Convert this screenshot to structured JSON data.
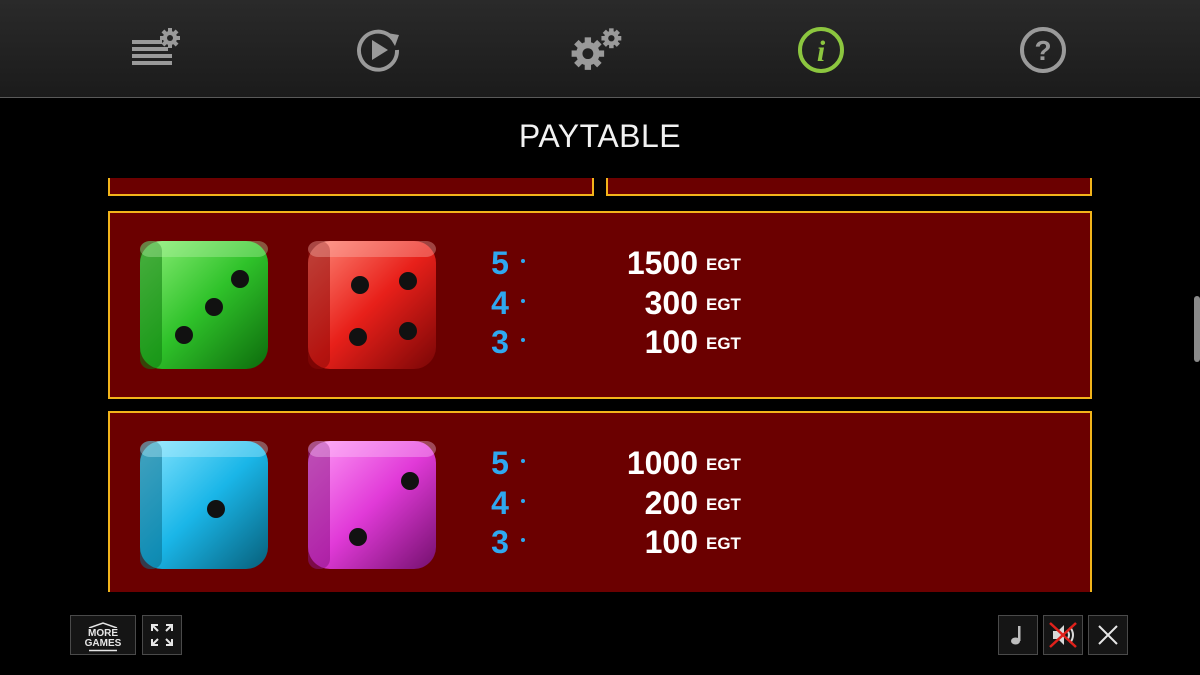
{
  "toolbar": {
    "buttons": [
      {
        "name": "bet-settings-icon"
      },
      {
        "name": "autoplay-icon"
      },
      {
        "name": "settings-icon"
      },
      {
        "name": "info-icon",
        "active": true
      },
      {
        "name": "help-icon"
      }
    ],
    "colors": {
      "icon": "#9a9a9a",
      "active": "#8cc63f"
    }
  },
  "title": "PAYTABLE",
  "paytable": [
    {
      "symbols": [
        {
          "name": "green-die-icon",
          "color": "#2fc22a",
          "pips": 3
        },
        {
          "name": "red-die-icon",
          "color": "#e8201a",
          "pips": 4
        }
      ],
      "rows": [
        {
          "count": "5",
          "amount": "1500",
          "currency": "EGT"
        },
        {
          "count": "4",
          "amount": "300",
          "currency": "EGT"
        },
        {
          "count": "3",
          "amount": "100",
          "currency": "EGT"
        }
      ]
    },
    {
      "symbols": [
        {
          "name": "blue-die-icon",
          "color": "#1ab6e8",
          "pips": 1
        },
        {
          "name": "magenta-die-icon",
          "color": "#e13ad8",
          "pips": 2
        }
      ],
      "rows": [
        {
          "count": "5",
          "amount": "1000",
          "currency": "EGT"
        },
        {
          "count": "4",
          "amount": "200",
          "currency": "EGT"
        },
        {
          "count": "3",
          "amount": "100",
          "currency": "EGT"
        }
      ]
    }
  ],
  "bottom": {
    "more_games_line1": "MORE",
    "more_games_line2": "GAMES"
  },
  "colors": {
    "panel": "#6b0000",
    "border": "#f2b41b",
    "count": "#2fa8f0"
  }
}
